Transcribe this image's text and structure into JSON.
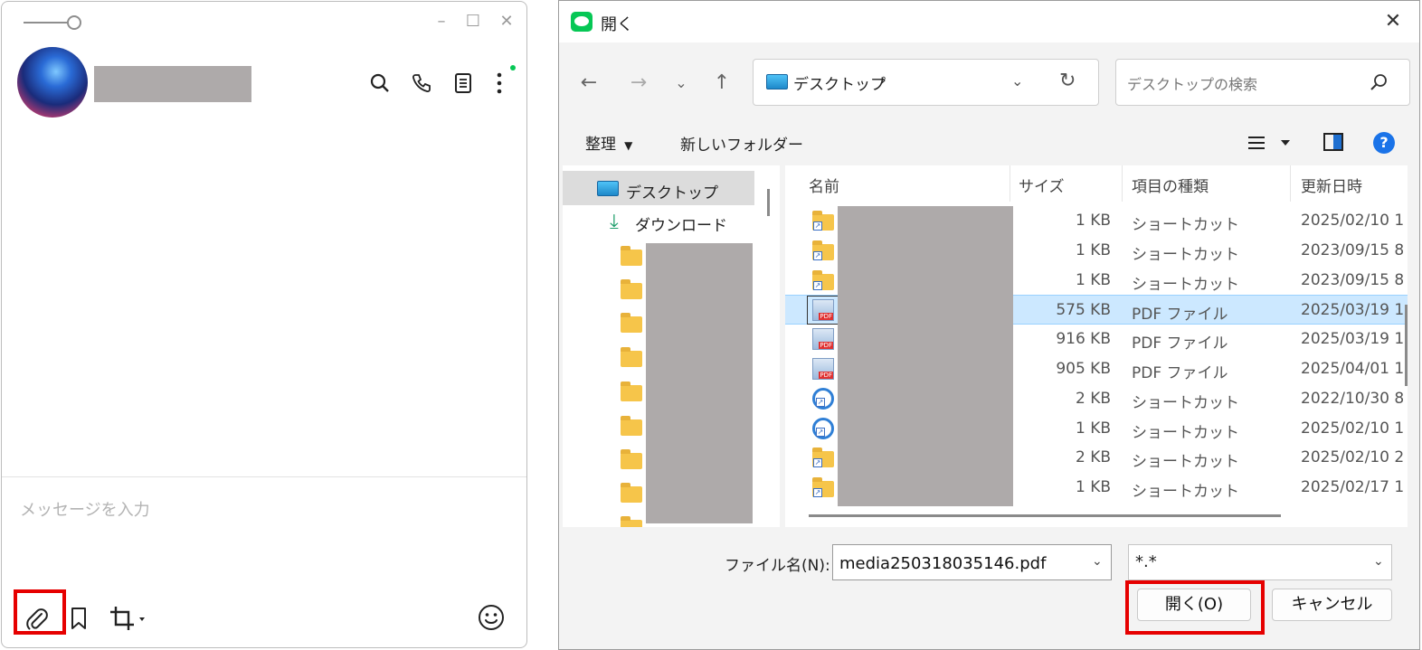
{
  "line": {
    "compose_placeholder": "メッセージを入力"
  },
  "dialog": {
    "title": "開く",
    "address": {
      "location": "デスクトップ",
      "separator": "›"
    },
    "search_placeholder": "デスクトップの検索",
    "toolbar": {
      "organize": "整理",
      "new_folder": "新しいフォルダー"
    },
    "tree": {
      "selected": "デスクトップ",
      "downloads": "ダウンロード"
    },
    "columns": {
      "name": "名前",
      "size": "サイズ",
      "type": "項目の種類",
      "modified": "更新日時"
    },
    "files": [
      {
        "icon": "folder-shortcut",
        "size": "1 KB",
        "type": "ショートカット",
        "modified": "2025/02/10 1"
      },
      {
        "icon": "folder-shortcut",
        "size": "1 KB",
        "type": "ショートカット",
        "modified": "2023/09/15 8"
      },
      {
        "icon": "folder-shortcut",
        "size": "1 KB",
        "type": "ショートカット",
        "modified": "2023/09/15 8"
      },
      {
        "icon": "pdf",
        "size": "575 KB",
        "type": "PDF ファイル",
        "modified": "2025/03/19 1",
        "selected": true
      },
      {
        "icon": "pdf",
        "size": "916 KB",
        "type": "PDF ファイル",
        "modified": "2025/03/19 1"
      },
      {
        "icon": "pdf",
        "size": "905 KB",
        "type": "PDF ファイル",
        "modified": "2025/04/01 1"
      },
      {
        "icon": "app-shortcut",
        "size": "2 KB",
        "type": "ショートカット",
        "modified": "2022/10/30 8"
      },
      {
        "icon": "app-shortcut",
        "size": "1 KB",
        "type": "ショートカット",
        "modified": "2025/02/10 1"
      },
      {
        "icon": "folder-shortcut",
        "size": "2 KB",
        "type": "ショートカット",
        "modified": "2025/02/10 2"
      },
      {
        "icon": "folder-shortcut",
        "size": "1 KB",
        "type": "ショートカット",
        "modified": "2025/02/17 1"
      }
    ],
    "filename_label": "ファイル名(N):",
    "filename_value": "media250318035146.pdf",
    "filter_value": "*.*",
    "open_button": "開く(O)",
    "cancel_button": "キャンセル"
  },
  "colors": {
    "highlight": "#e60000",
    "line_green": "#06c755",
    "selection": "#cce8ff"
  }
}
